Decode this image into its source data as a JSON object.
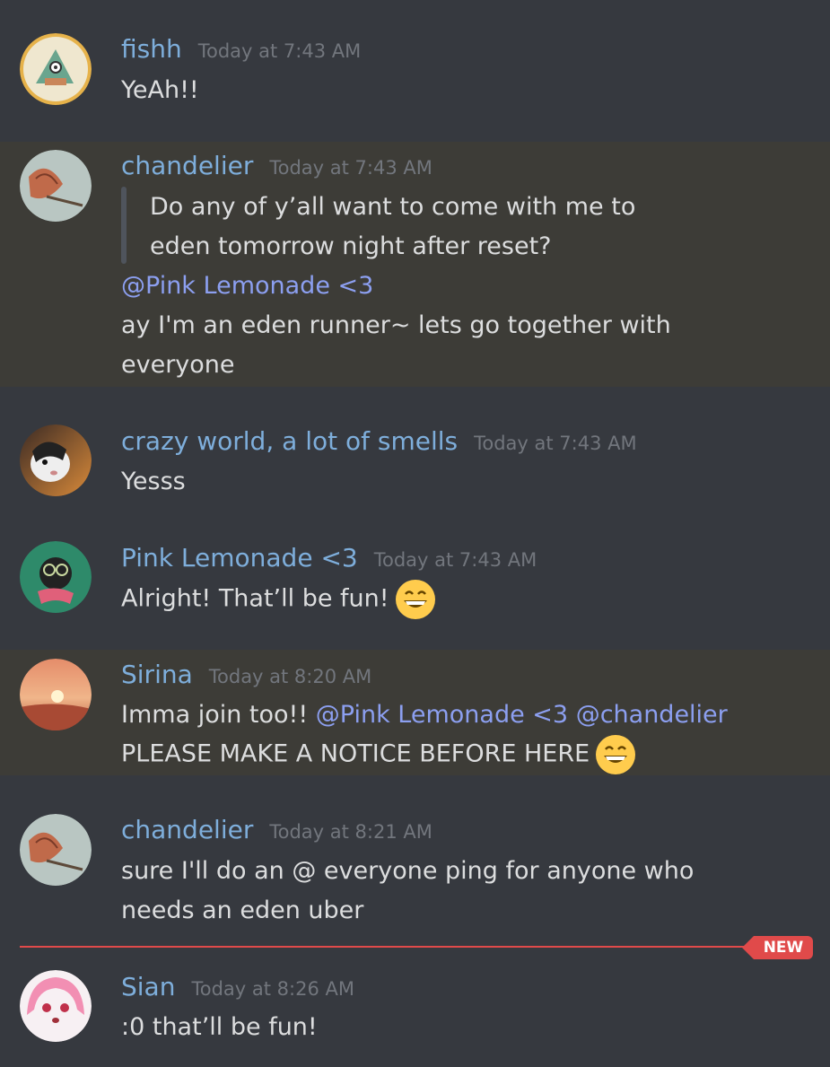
{
  "messages": [
    {
      "author": "fishh",
      "time": "Today at 7:43 AM",
      "lines": [
        "YeAh!!"
      ]
    },
    {
      "author": "chandelier",
      "time": "Today at 7:43 AM",
      "quote": [
        "Do any of y’all want to come with me to",
        "eden tomorrow night after reset?"
      ],
      "mention": "@Pink Lemonade <3",
      "lines": [
        "ay I'm an eden runner~ lets go together with",
        "everyone"
      ]
    },
    {
      "author": "crazy world, a lot of smells",
      "time": "Today at 7:43 AM",
      "lines": [
        "Yesss"
      ]
    },
    {
      "author": "Pink Lemonade <3",
      "time": "Today at 7:43 AM",
      "lines": [
        "Alright! That’ll be fun!"
      ],
      "emoji": "grinning-face-emoji"
    },
    {
      "author": "Sirina",
      "time": "Today at 8:20 AM",
      "line1_text": "Imma join too!!",
      "mention1": "@Pink Lemonade <3",
      "mention2": "@chandelier",
      "line2_text": "PLEASE MAKE A NOTICE BEFORE HERE",
      "emoji": "grinning-face-emoji"
    },
    {
      "author": "chandelier",
      "time": "Today at 8:21 AM",
      "lines": [
        "sure I'll do an @ everyone ping for anyone who",
        "needs an eden uber"
      ]
    },
    {
      "author": "Sian",
      "time": "Today at 8:26 AM",
      "lines": [
        ":0 that’ll be fun!"
      ]
    }
  ],
  "new_divider": {
    "label": "NEW"
  },
  "colors": {
    "background": "#36393f",
    "highlight": "#3d3c37",
    "username": "#7eaedb",
    "timestamp": "#72767d",
    "mention": "#8c9ff0",
    "new_marker": "#e04a4a"
  }
}
